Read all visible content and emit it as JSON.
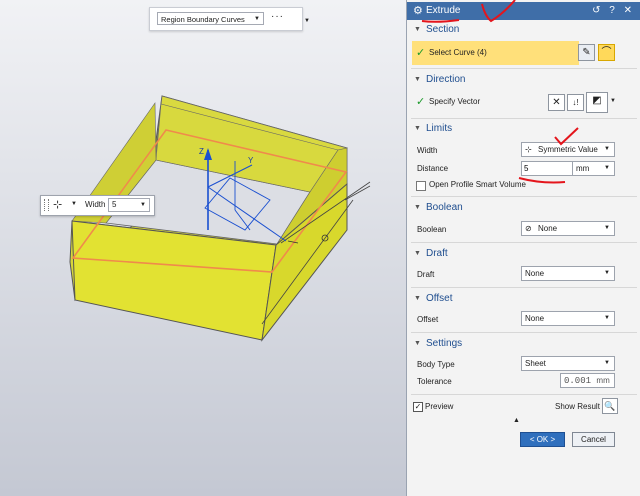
{
  "toolbar": {
    "selection_filter": "Region Boundary Curves",
    "more_label": "···"
  },
  "viewport": {
    "width_label": "Width",
    "width_value": "5",
    "axis_z": "Z",
    "axis_y": "Y"
  },
  "dialog": {
    "title": "Extrude",
    "controls": "↺ ? ✕",
    "sections": {
      "section": {
        "title": "Section",
        "select_curve": "Select Curve (4)"
      },
      "direction": {
        "title": "Direction",
        "specify_vector": "Specify Vector"
      },
      "limits": {
        "title": "Limits",
        "width_label": "Width",
        "width_value": "Symmetric Value",
        "distance_label": "Distance",
        "distance_value": "5",
        "distance_unit": "mm",
        "open_profile": "Open Profile Smart Volume"
      },
      "boolean": {
        "title": "Boolean",
        "label": "Boolean",
        "value": "None"
      },
      "draft": {
        "title": "Draft",
        "label": "Draft",
        "value": "None"
      },
      "offset": {
        "title": "Offset",
        "label": "Offset",
        "value": "None"
      },
      "settings": {
        "title": "Settings",
        "body_type_label": "Body Type",
        "body_type_value": "Sheet",
        "tolerance_label": "Tolerance",
        "tolerance_value": "0.001",
        "tolerance_unit": "mm"
      }
    },
    "preview_label": "Preview",
    "show_result_label": "Show Result",
    "ok_label": "< OK >",
    "cancel_label": "Cancel",
    "colors": {
      "title_bar": "#3f6ea8",
      "section_text": "#1f4e8f",
      "highlight_row": "#ffe07a",
      "ok_button": "#2f6fbd",
      "annotation": "#e4151c"
    }
  }
}
